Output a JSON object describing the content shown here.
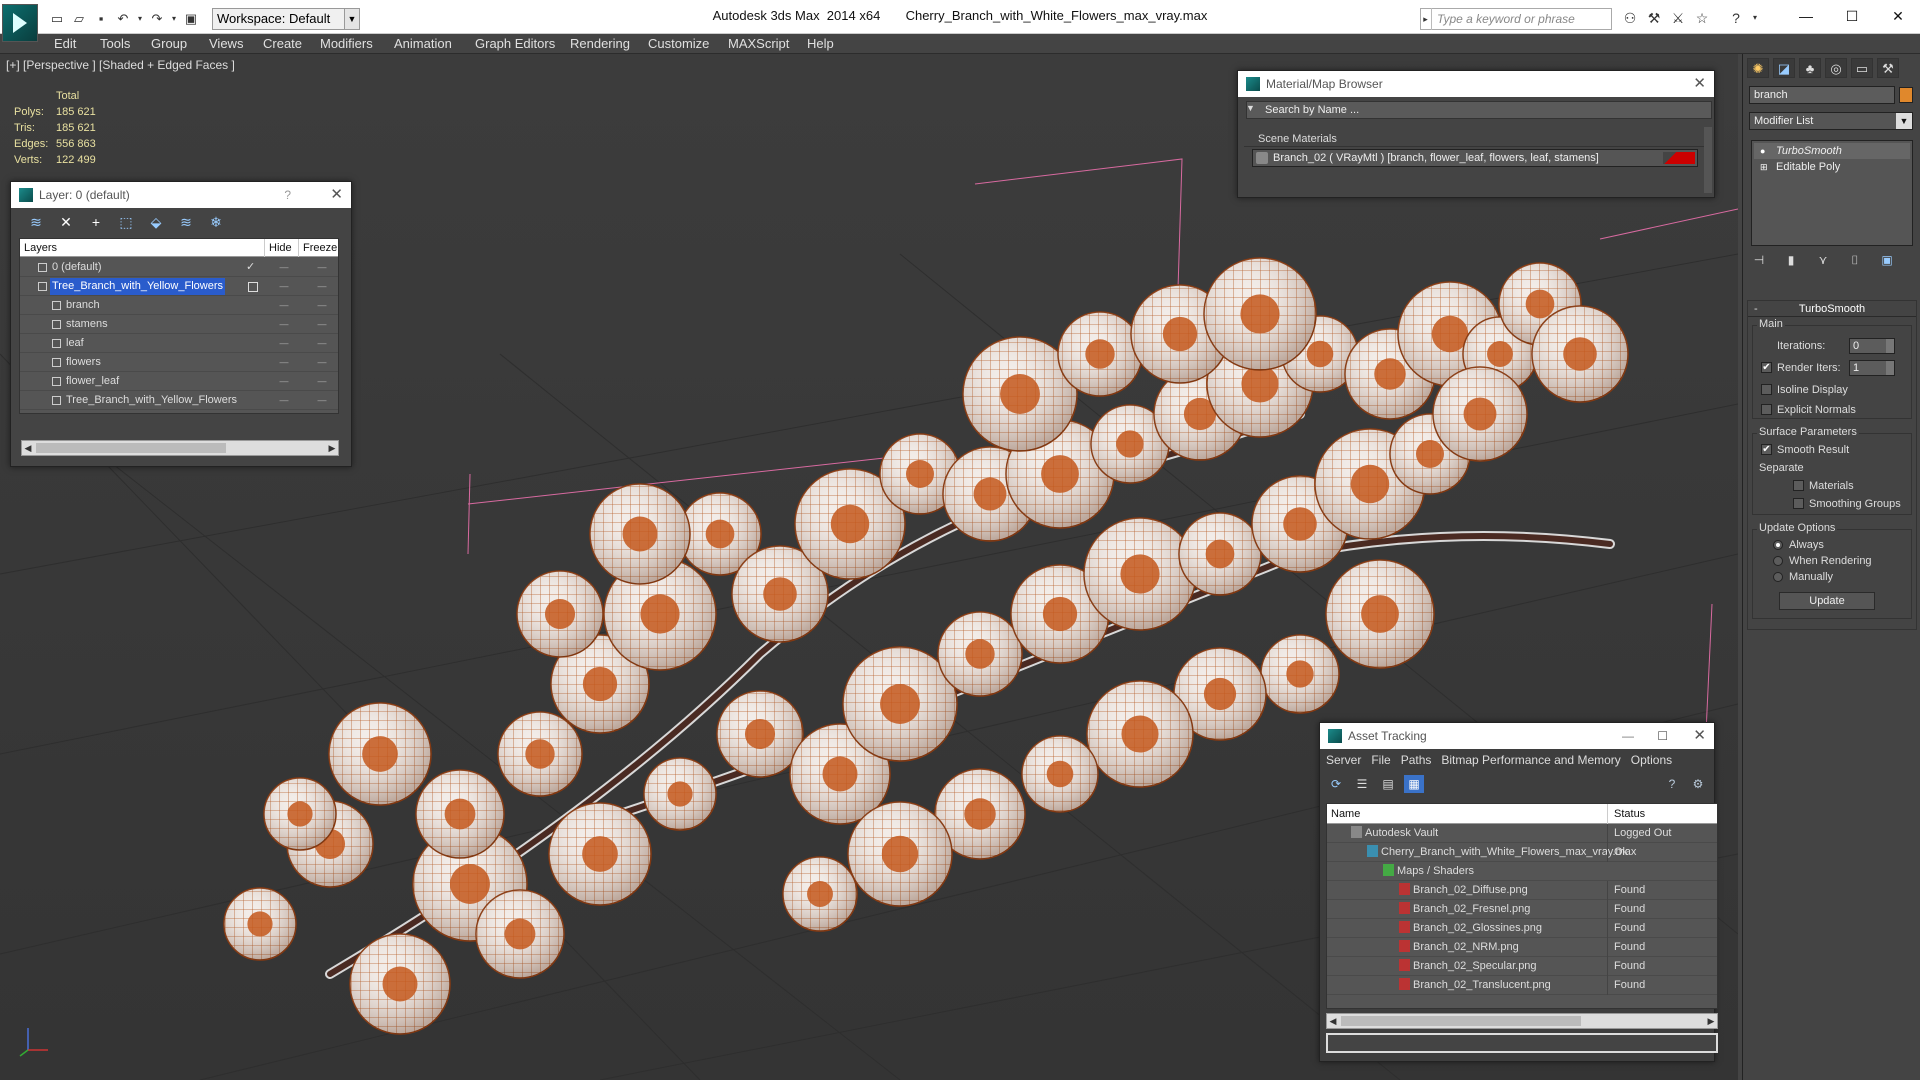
{
  "app": {
    "title": "Autodesk 3ds Max  2014 x64       Cherry_Branch_with_White_Flowers_max_vray.max",
    "workspace": "Workspace: Default",
    "search_placeholder": "Type a keyword or phrase"
  },
  "menu": [
    "Edit",
    "Tools",
    "Group",
    "Views",
    "Create",
    "Modifiers",
    "Animation",
    "Graph Editors",
    "Rendering",
    "Customize",
    "MAXScript",
    "Help"
  ],
  "viewport": {
    "label": "[+] [Perspective ] [Shaded + Edged Faces ]",
    "stats": {
      "header": "Total",
      "rows": [
        {
          "label": "Polys:",
          "value": "185 621"
        },
        {
          "label": "Tris:",
          "value": "185 621"
        },
        {
          "label": "Edges:",
          "value": "556 863"
        },
        {
          "label": "Verts:",
          "value": "122 499"
        }
      ]
    }
  },
  "layer_panel": {
    "title": "Layer: 0 (default)",
    "help": "?",
    "columns": {
      "layers": "Layers",
      "hide": "Hide",
      "freeze": "Freeze"
    },
    "rows": [
      {
        "name": "0 (default)",
        "indent": 0,
        "selected": false
      },
      {
        "name": "Tree_Branch_with_Yellow_Flowers",
        "indent": 0,
        "selected": true
      },
      {
        "name": "branch",
        "indent": 1,
        "selected": false
      },
      {
        "name": "stamens",
        "indent": 1,
        "selected": false
      },
      {
        "name": "leaf",
        "indent": 1,
        "selected": false
      },
      {
        "name": "flowers",
        "indent": 1,
        "selected": false
      },
      {
        "name": "flower_leaf",
        "indent": 1,
        "selected": false
      },
      {
        "name": "Tree_Branch_with_Yellow_Flowers",
        "indent": 1,
        "selected": false
      }
    ]
  },
  "material_browser": {
    "title": "Material/Map Browser",
    "search": "Search by Name ...",
    "section": "Scene Materials",
    "item": "Branch_02  ( VRayMtl )  [branch, flower_leaf, flowers, leaf, stamens]"
  },
  "command_panel": {
    "object_name": "branch",
    "modifier_list": "Modifier List",
    "stack": [
      "TurboSmooth",
      "Editable Poly"
    ],
    "rollout": "TurboSmooth",
    "main": "Main",
    "iterations_label": "Iterations:",
    "iterations": "0",
    "render_iters_label": "Render Iters:",
    "render_iters": "1",
    "isoline": "Isoline Display",
    "explicit": "Explicit Normals",
    "surface": "Surface Parameters",
    "smooth_result": "Smooth Result",
    "separate": "Separate",
    "materials": "Materials",
    "smoothing_groups": "Smoothing Groups",
    "update_options": "Update Options",
    "always": "Always",
    "when_rendering": "When Rendering",
    "manually": "Manually",
    "update": "Update"
  },
  "asset_tracking": {
    "title": "Asset Tracking",
    "menu": [
      "Server",
      "File",
      "Paths",
      "Bitmap Performance and Memory",
      "Options"
    ],
    "columns": {
      "name": "Name",
      "status": "Status"
    },
    "rows": [
      {
        "name": "Autodesk Vault",
        "status": "Logged Out",
        "indent": 0,
        "icon": "vault"
      },
      {
        "name": "Cherry_Branch_with_White_Flowers_max_vray.max",
        "status": "Ok",
        "indent": 1,
        "icon": "max"
      },
      {
        "name": "Maps / Shaders",
        "status": "",
        "indent": 2,
        "icon": "maps"
      },
      {
        "name": "Branch_02_Diffuse.png",
        "status": "Found",
        "indent": 3,
        "icon": "png"
      },
      {
        "name": "Branch_02_Fresnel.png",
        "status": "Found",
        "indent": 3,
        "icon": "png"
      },
      {
        "name": "Branch_02_Glossines.png",
        "status": "Found",
        "indent": 3,
        "icon": "png"
      },
      {
        "name": "Branch_02_NRM.png",
        "status": "Found",
        "indent": 3,
        "icon": "png"
      },
      {
        "name": "Branch_02_Specular.png",
        "status": "Found",
        "indent": 3,
        "icon": "png"
      },
      {
        "name": "Branch_02_Translucent.png",
        "status": "Found",
        "indent": 3,
        "icon": "png"
      }
    ]
  },
  "colors": {
    "selection": "#2a5ccc",
    "wire": "#c4581c",
    "object_color": "#e0882c"
  }
}
